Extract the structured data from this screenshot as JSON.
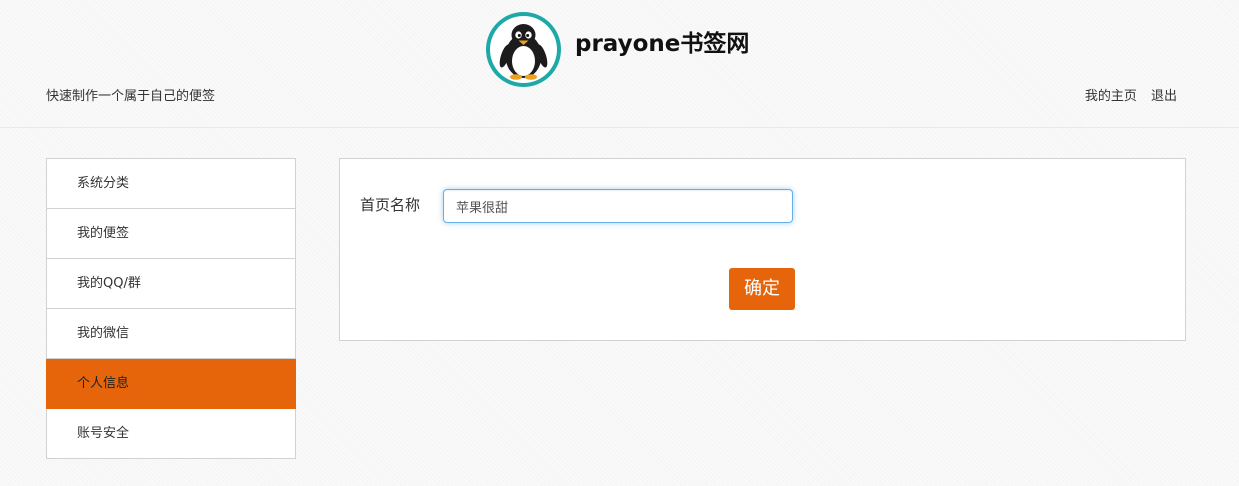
{
  "header": {
    "logo_icon": "penguin-avatar-icon",
    "site_name": "prayone书签网",
    "tagline": "快速制作一个属于自己的便签",
    "links": [
      {
        "label": "我的主页"
      },
      {
        "label": "退出"
      }
    ]
  },
  "sidebar": {
    "items": [
      {
        "label": "系统分类",
        "active": false
      },
      {
        "label": "我的便签",
        "active": false
      },
      {
        "label": "我的QQ/群",
        "active": false
      },
      {
        "label": "我的微信",
        "active": false
      },
      {
        "label": "个人信息",
        "active": true
      },
      {
        "label": "账号安全",
        "active": false
      }
    ]
  },
  "form": {
    "homepage_name_label": "首页名称",
    "homepage_name_value": "苹果很甜",
    "submit_label": "确定"
  },
  "colors": {
    "accent": "#e6650a",
    "logo_ring": "#1ea8a8",
    "input_focus": "#66afe9"
  }
}
